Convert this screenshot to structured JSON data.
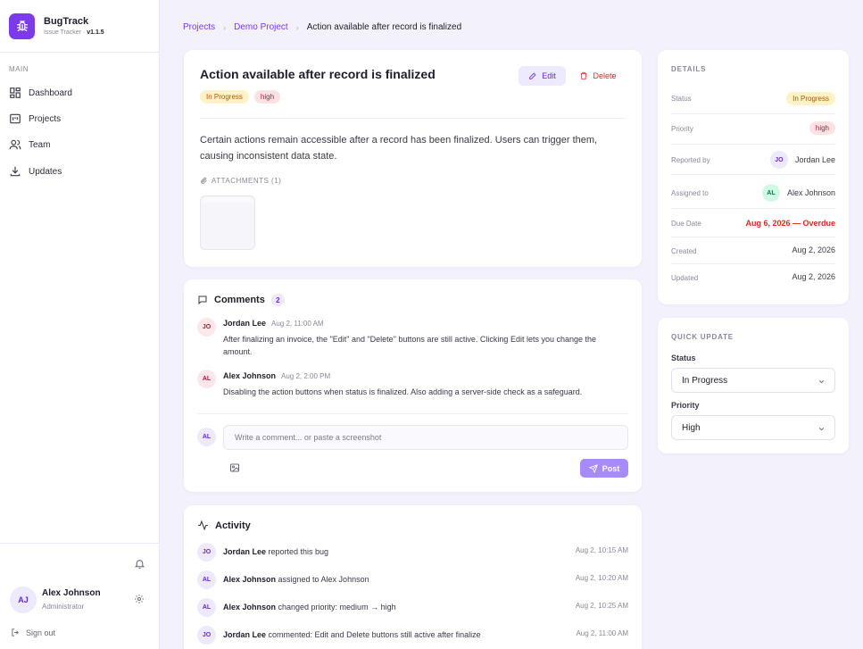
{
  "app": {
    "name": "BugTrack",
    "subtitle": "Issue Tracker · ",
    "version": "v1.1.5"
  },
  "sidebar": {
    "section": "MAIN",
    "items": [
      {
        "label": "Dashboard",
        "icon": "dashboard-icon"
      },
      {
        "label": "Projects",
        "icon": "projects-icon"
      },
      {
        "label": "Team",
        "icon": "team-icon"
      },
      {
        "label": "Updates",
        "icon": "download-icon"
      }
    ],
    "user": {
      "initials": "AJ",
      "name": "Alex Johnson",
      "role": "Administrator"
    },
    "signout": "Sign out"
  },
  "breadcrumb": {
    "root": "Projects",
    "project": "Demo Project",
    "current": "Action available after record is finalized"
  },
  "issue": {
    "title": "Action available after record is finalized",
    "status": "In Progress",
    "priority": "high",
    "edit_label": "Edit",
    "delete_label": "Delete",
    "description": "Certain actions remain accessible after a record has been finalized. Users can trigger them, causing inconsistent data state.",
    "attachments_label": "ATTACHMENTS (1)"
  },
  "comments": {
    "title": "Comments",
    "count": "2",
    "items": [
      {
        "initials": "JO",
        "author": "Jordan Lee",
        "time": "Aug 2, 11:00 AM",
        "text": "After finalizing an invoice, the \"Edit\" and \"Delete\" buttons are still active. Clicking Edit lets you change the amount."
      },
      {
        "initials": "AL",
        "author": "Alex Johnson",
        "time": "Aug 2, 2:00 PM",
        "text": "Disabling the action buttons when status is finalized. Also adding a server-side check as a safeguard."
      }
    ],
    "input_initials": "AL",
    "placeholder": "Write a comment... or paste a screenshot",
    "post_label": "Post"
  },
  "activity": {
    "title": "Activity",
    "items": [
      {
        "initials": "JO",
        "actor": "Jordan Lee",
        "action": " reported this bug",
        "time": "Aug 2, 10:15 AM"
      },
      {
        "initials": "AL",
        "actor": "Alex Johnson",
        "action": " assigned to Alex Johnson",
        "time": "Aug 2, 10:20 AM"
      },
      {
        "initials": "AL",
        "actor": "Alex Johnson",
        "action": " changed priority: medium → high",
        "time": "Aug 2, 10:25 AM"
      },
      {
        "initials": "JO",
        "actor": "Jordan Lee",
        "action": " commented: Edit and Delete buttons still active after finalize",
        "time": "Aug 2, 11:00 AM"
      }
    ]
  },
  "details": {
    "title": "DETAILS",
    "status_label": "Status",
    "status": "In Progress",
    "priority_label": "Priority",
    "priority": "high",
    "reported_label": "Reported by",
    "reported_initials": "JO",
    "reported_name": "Jordan Lee",
    "assigned_label": "Assigned to",
    "assigned_initials": "AL",
    "assigned_name": "Alex Johnson",
    "due_label": "Due Date",
    "due": "Aug 6, 2026 — Overdue",
    "created_label": "Created",
    "created": "Aug 2, 2026",
    "updated_label": "Updated",
    "updated": "Aug 2, 2026"
  },
  "quick_update": {
    "title": "QUICK UPDATE",
    "status_label": "Status",
    "status_value": "In Progress",
    "priority_label": "Priority",
    "priority_value": "High"
  },
  "colors": {
    "accent": "#7c3aed",
    "danger": "#dc2626",
    "background": "#f3f1fb"
  }
}
